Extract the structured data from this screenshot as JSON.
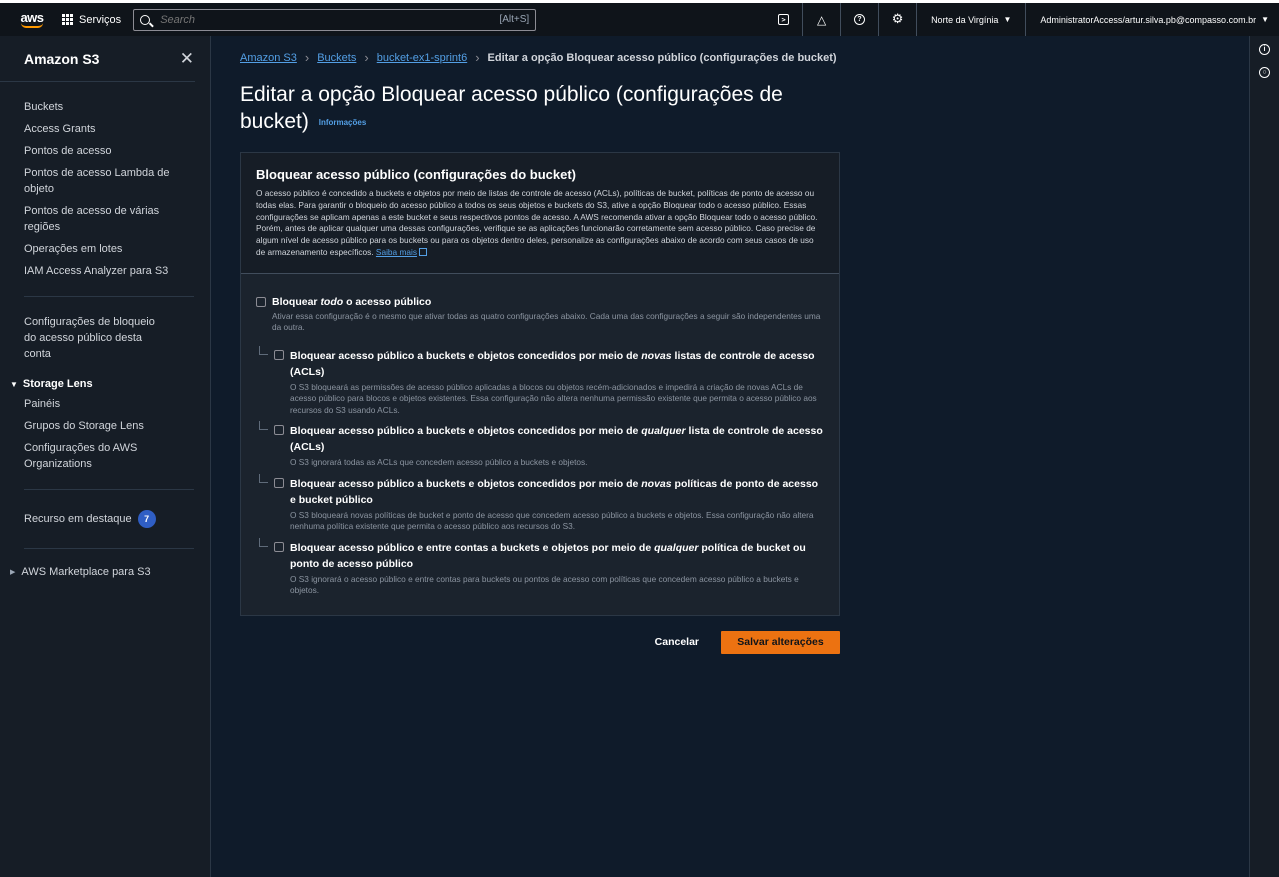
{
  "topbar": {
    "logo": "aws",
    "services_label": "Serviços",
    "search_placeholder": "Search",
    "search_shortcut": "[Alt+S]",
    "region": "Norte da Virgínia",
    "account": "AdministratorAccess/artur.silva.pb@compasso.com.br"
  },
  "sidebar": {
    "title": "Amazon S3",
    "items": [
      "Buckets",
      "Access Grants",
      "Pontos de acesso",
      "Pontos de acesso Lambda de objeto",
      "Pontos de acesso de várias regiões",
      "Operações em lotes",
      "IAM Access Analyzer para S3"
    ],
    "block_settings": "Configurações de bloqueio do acesso público desta conta",
    "storage_lens": {
      "title": "Storage Lens",
      "items": [
        "Painéis",
        "Grupos do Storage Lens",
        "Configurações do AWS Organizations"
      ]
    },
    "featured": {
      "label": "Recurso em destaque",
      "count": "7"
    },
    "marketplace": "AWS Marketplace para S3"
  },
  "breadcrumb": {
    "items": [
      "Amazon S3",
      "Buckets",
      "bucket-ex1-sprint6"
    ],
    "current": "Editar a opção Bloquear acesso público (configurações de bucket)"
  },
  "page": {
    "title": "Editar a opção Bloquear acesso público (configurações de bucket)",
    "info_label": "Informações"
  },
  "panel": {
    "title": "Bloquear acesso público (configurações do bucket)",
    "description": "O acesso público é concedido a buckets e objetos por meio de listas de controle de acesso (ACLs), políticas de bucket, políticas de ponto de acesso ou todas elas. Para garantir o bloqueio do acesso público a todos os seus objetos e buckets do S3, ative a opção Bloquear todo o acesso público. Essas configurações se aplicam apenas a este bucket e seus respectivos pontos de acesso. A AWS recomenda ativar a opção Bloquear todo o acesso público. Porém, antes de aplicar qualquer uma dessas configurações, verifique se as aplicações funcionarão corretamente sem acesso público. Caso precise de algum nível de acesso público para os buckets ou para os objetos dentro deles, personalize as configurações abaixo de acordo com seus casos de uso de armazenamento específicos.",
    "learn_more": "Saiba mais",
    "block_all": {
      "label_pre": "Bloquear ",
      "label_em": "todo",
      "label_post": " o acesso público",
      "description": "Ativar essa configuração é o mesmo que ativar todas as quatro configurações abaixo. Cada uma das configurações a seguir são independentes uma da outra."
    },
    "options": [
      {
        "label_pre": "Bloquear acesso público a buckets e objetos concedidos por meio de ",
        "label_em": "novas",
        "label_post": " listas de controle de acesso (ACLs)",
        "description": "O S3 bloqueará as permissões de acesso público aplicadas a blocos ou objetos recém-adicionados e impedirá a criação de novas ACLs de acesso público para blocos e objetos existentes. Essa configuração não altera nenhuma permissão existente que permita o acesso público aos recursos do S3 usando ACLs."
      },
      {
        "label_pre": "Bloquear acesso público a buckets e objetos concedidos por meio de ",
        "label_em": "qualquer",
        "label_post": " lista de controle de acesso (ACLs)",
        "description": "O S3 ignorará todas as ACLs que concedem acesso público a buckets e objetos."
      },
      {
        "label_pre": "Bloquear acesso público a buckets e objetos concedidos por meio de ",
        "label_em": "novas",
        "label_post": " políticas de ponto de acesso e bucket público",
        "description": "O S3 bloqueará novas políticas de bucket e ponto de acesso que concedem acesso público a buckets e objetos. Essa configuração não altera nenhuma política existente que permita o acesso público aos recursos do S3."
      },
      {
        "label_pre": "Bloquear acesso público e entre contas a buckets e objetos por meio de ",
        "label_em": "qualquer",
        "label_post": " política de bucket ou ponto de acesso público",
        "description": "O S3 ignorará o acesso público e entre contas para buckets ou pontos de acesso com políticas que concedem acesso público a buckets e objetos."
      }
    ]
  },
  "actions": {
    "cancel": "Cancelar",
    "save": "Salvar alterações"
  },
  "colors": {
    "accent": "#ec7211",
    "link": "#539fe5",
    "background": "#0f1b2a"
  }
}
